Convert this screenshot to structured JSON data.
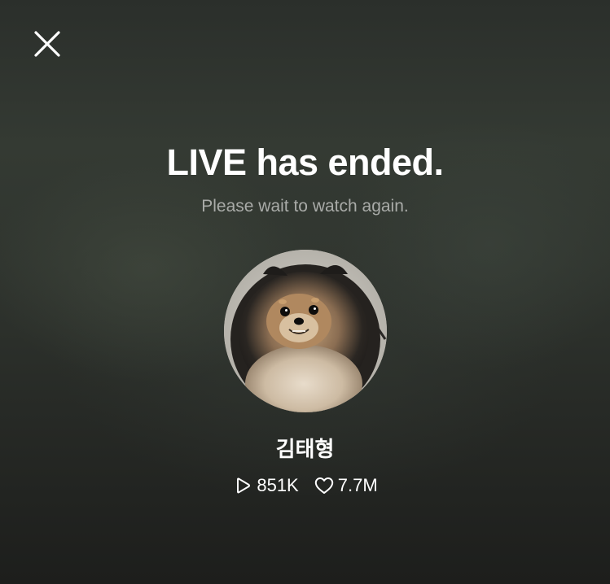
{
  "header": {
    "close_icon": "close-icon"
  },
  "main": {
    "title": "LIVE has ended.",
    "subtitle": "Please wait to watch again.",
    "profile": {
      "name": "김태형",
      "avatar_icon": "pomeranian-dog-photo"
    },
    "stats": {
      "plays": "851K",
      "plays_icon": "play-icon",
      "likes": "7.7M",
      "likes_icon": "heart-icon"
    }
  },
  "colors": {
    "title": "#ffffff",
    "subtitle": "#a9aba8",
    "background": "#2e322d"
  }
}
